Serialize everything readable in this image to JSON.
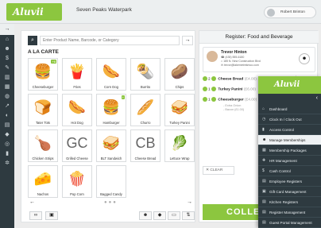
{
  "header": {
    "brand": "Aluvii",
    "venue": "Seven Peaks Waterpark",
    "user": "Robert Brinton"
  },
  "sidebar_icons": [
    "arrow-right-icon",
    "home-icon",
    "people-icon",
    "dollar-icon",
    "wrench-icon",
    "chart-icon",
    "calendar-icon",
    "globe-icon",
    "chart2-icon",
    "bell-icon",
    "gear-icon",
    "cube-icon",
    "globe2-icon",
    "cog-icon"
  ],
  "search": {
    "placeholder": "Enter Product Name, Barcode, or Category"
  },
  "catalog": {
    "section_title": "A LA CARTE",
    "items": [
      {
        "label": "Cheeseburger",
        "glyph": "🍔",
        "badge": "+6"
      },
      {
        "label": "Fries",
        "glyph": "🍟",
        "badge": ""
      },
      {
        "label": "Corn Dog",
        "glyph": "🌭",
        "badge": ""
      },
      {
        "label": "Burrito",
        "glyph": "🌯",
        "badge": ""
      },
      {
        "label": "Chips",
        "glyph": "🥔",
        "badge": ""
      },
      {
        "label": "Tater Tots",
        "glyph": "🍞",
        "badge": ""
      },
      {
        "label": "Hot Dog",
        "glyph": "🌭",
        "badge": ""
      },
      {
        "label": "Hamburger",
        "glyph": "🍔",
        "badge": "+"
      },
      {
        "label": "Churro",
        "glyph": "🥖",
        "badge": ""
      },
      {
        "label": "Turkey Panini",
        "glyph": "🥪",
        "badge": ""
      },
      {
        "label": "Chicken Strips",
        "glyph": "🍗",
        "badge": ""
      },
      {
        "label": "Grilled Cheese",
        "glyph": "🧀",
        "badge": ""
      },
      {
        "label": "BLT Sandwich",
        "glyph": "🥪",
        "badge": ""
      },
      {
        "label": "Cheese Bread",
        "glyph": "",
        "text": "CB",
        "badge": ""
      },
      {
        "label": "Lettuce Wrap",
        "glyph": "🥬",
        "badge": ""
      },
      {
        "label": "Nachos",
        "glyph": "🧀",
        "badge": ""
      },
      {
        "label": "Pop Corn",
        "glyph": "🍿",
        "badge": ""
      },
      {
        "label": "Bagged Candy",
        "glyph": "",
        "text": "",
        "badge": ""
      }
    ],
    "gc_text": "GC"
  },
  "footer": {
    "left_icons": [
      "glasses-icon",
      "gift-icon"
    ],
    "right_icons": [
      "add-person-icon",
      "tag-icon",
      "print-icon",
      "sort-icon"
    ]
  },
  "cart": {
    "title": "Register: Food and Beverage",
    "customer": {
      "name": "Trevor Hinton",
      "phone": "☎ (435) 555-6180",
      "address": "⌂ 185 N. New Construction Blvd",
      "email": "✉ trevor@lakemetrekmoo.com"
    },
    "lines": [
      {
        "qty": "2",
        "name": "Cheese Bread",
        "sub": "(£4.00)",
        "price": "$8.00"
      },
      {
        "qty": "1",
        "name": "Turkey Panini",
        "sub": "(£6.00)",
        "price": ""
      },
      {
        "qty": "1",
        "name": "Cheeseburger",
        "sub": "(£4.00)",
        "price": ""
      }
    ],
    "modifiers": [
      "- Extra Onion",
      "- Bacon (£1.00)"
    ],
    "clear_label": "✕ CLEAR",
    "collect_label": "COLLEC"
  },
  "popup_menu": {
    "brand": "Aluvii",
    "items": [
      {
        "label": "Dashboard",
        "icon": "⌂"
      },
      {
        "label": "Clock In / Clock Out",
        "icon": "◷"
      },
      {
        "label": "Access Control",
        "icon": "▮"
      },
      {
        "label": "Manage Memberships",
        "icon": "☻"
      },
      {
        "label": "Membership Packages",
        "icon": "▦"
      },
      {
        "label": "HR Management",
        "icon": "✚"
      },
      {
        "label": "Cash Control",
        "icon": "$"
      },
      {
        "label": "Employee Registers",
        "icon": "▤"
      },
      {
        "label": "Gift Card Management",
        "icon": "▣"
      },
      {
        "label": "Kitchen Registers",
        "icon": "▤"
      },
      {
        "label": "Register Management",
        "icon": "▤"
      },
      {
        "label": "Guest Portal Management",
        "icon": "▤"
      }
    ],
    "active_index": 3
  }
}
